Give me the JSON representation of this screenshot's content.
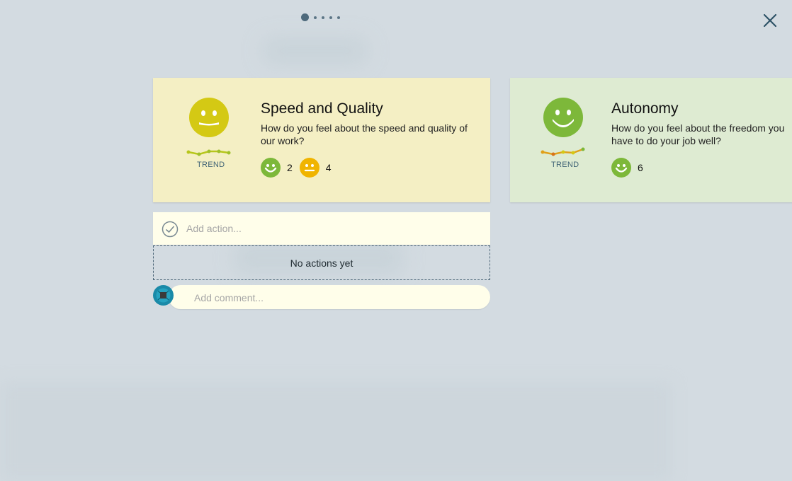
{
  "pager": {
    "count": 5,
    "active": 1
  },
  "close_icon": "close-icon",
  "cards": [
    {
      "title": "Speed and Quality",
      "question": "How do you feel about the speed and quality of our work?",
      "face": "neutral-happy",
      "face_color": "#d4c914",
      "trend_label": "TREND",
      "votes": [
        {
          "icon": "happy-smiley-icon",
          "color": "#7db83a",
          "count": "2"
        },
        {
          "icon": "neutral-smiley-icon",
          "color": "#f0b400",
          "count": "4"
        }
      ]
    },
    {
      "title": "Autonomy",
      "question": "How do you feel about the freedom you have to do your job well?",
      "face": "happy",
      "face_color": "#7db83a",
      "trend_label": "TREND",
      "votes": [
        {
          "icon": "happy-smiley-icon",
          "color": "#7db83a",
          "count": "6"
        }
      ]
    }
  ],
  "action": {
    "placeholder": "Add action...",
    "empty_text": "No actions yet"
  },
  "comment": {
    "placeholder": "Add comment..."
  },
  "colors": {
    "background": "#d3dbe1",
    "card_yellow": "#f4efc4",
    "card_green": "#deebd2",
    "input_bg": "#fffeea"
  }
}
